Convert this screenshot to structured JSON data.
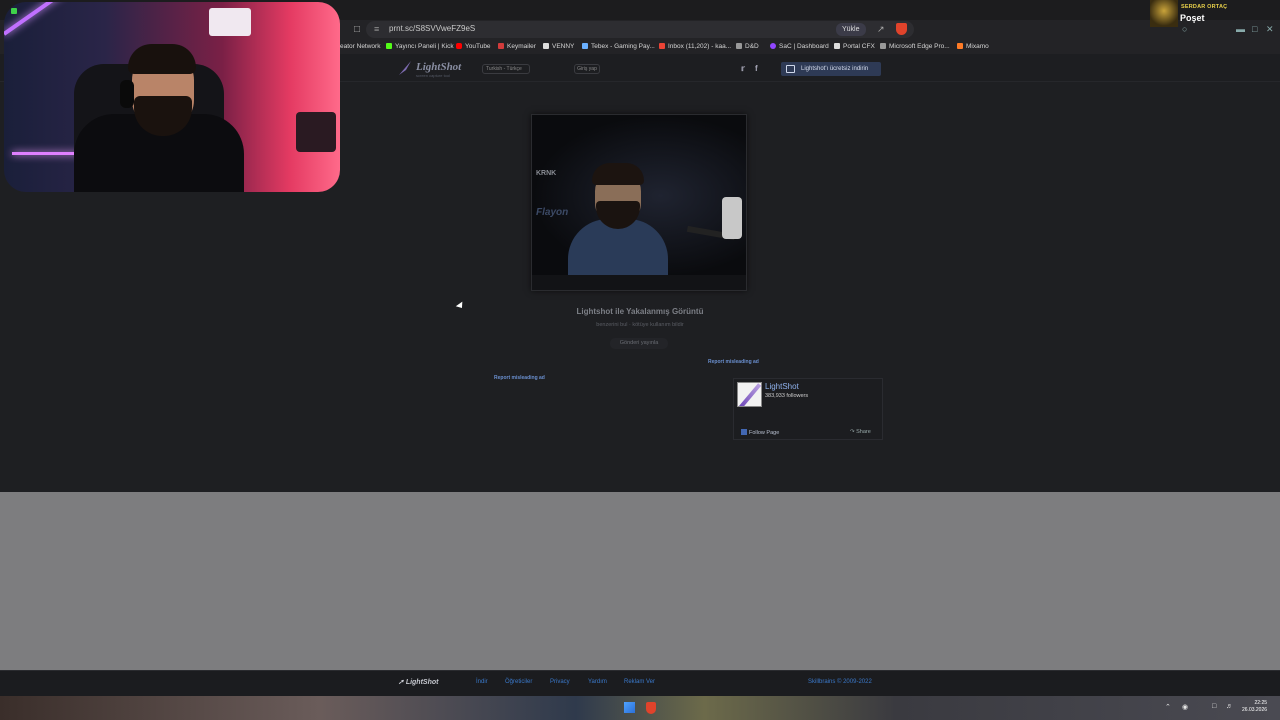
{
  "browser": {
    "url": "prnt.sc/S8SVVweFZ9eS",
    "upload_label": "Yükle",
    "bookmarks": [
      {
        "label": "eator Network",
        "color": "#888888"
      },
      {
        "label": "Yayıncı Paneli | Kick",
        "color": "#53fc18"
      },
      {
        "label": "YouTube",
        "color": "#ff0000"
      },
      {
        "label": "Keymailer",
        "color": "#d23b3b"
      },
      {
        "label": "VENNY",
        "color": "#dddddd"
      },
      {
        "label": "Tebex - Gaming Pay...",
        "color": "#6ab0ff"
      },
      {
        "label": "Inbox (11,202) - kaa...",
        "color": "#ea4335"
      },
      {
        "label": "D&D",
        "color": "#999999"
      },
      {
        "label": "SaC | Dashboard",
        "color": "#9146ff"
      },
      {
        "label": "Portal CFX",
        "color": "#dddddd"
      },
      {
        "label": "Microsoft Edge Pro...",
        "color": "#999999"
      },
      {
        "label": "Mixamo",
        "color": "#ff7b26"
      }
    ]
  },
  "stream_overlay": {
    "name": "SERDAR ORTAÇ",
    "title": "Poşet"
  },
  "lightshot": {
    "logo": "LightShot",
    "logo_sub": "screen capture tool",
    "language": "Turkish - Türkçe",
    "login": "Giriş yap",
    "download": "Lightshot'ı ücretsiz indirin",
    "shot_watermark": "KRNK",
    "shot_watermark2": "Flayon",
    "image_title": "Lightshot ile Yakalanmış Görüntü",
    "image_sub": "benzerini bul   ·   kötüye kullanım bildir",
    "send": "Gönderi yayınla",
    "report_ad_right": "Report misleading ad",
    "report_ad_left": "Report misleading ad",
    "fb": {
      "name": "LightShot",
      "followers": "383,933 followers",
      "follow": "Follow Page",
      "share": "Share"
    },
    "footer": {
      "logo": "LightShot",
      "links": [
        "İndir",
        "Öğreticiler",
        "Privacy",
        "Yardım",
        "Reklam Ver"
      ],
      "copy_link": "Skillbrains",
      "copy_rest": " © 2009-2022"
    }
  },
  "taskbar": {
    "time": "22:25",
    "date": "26.03.2026"
  }
}
